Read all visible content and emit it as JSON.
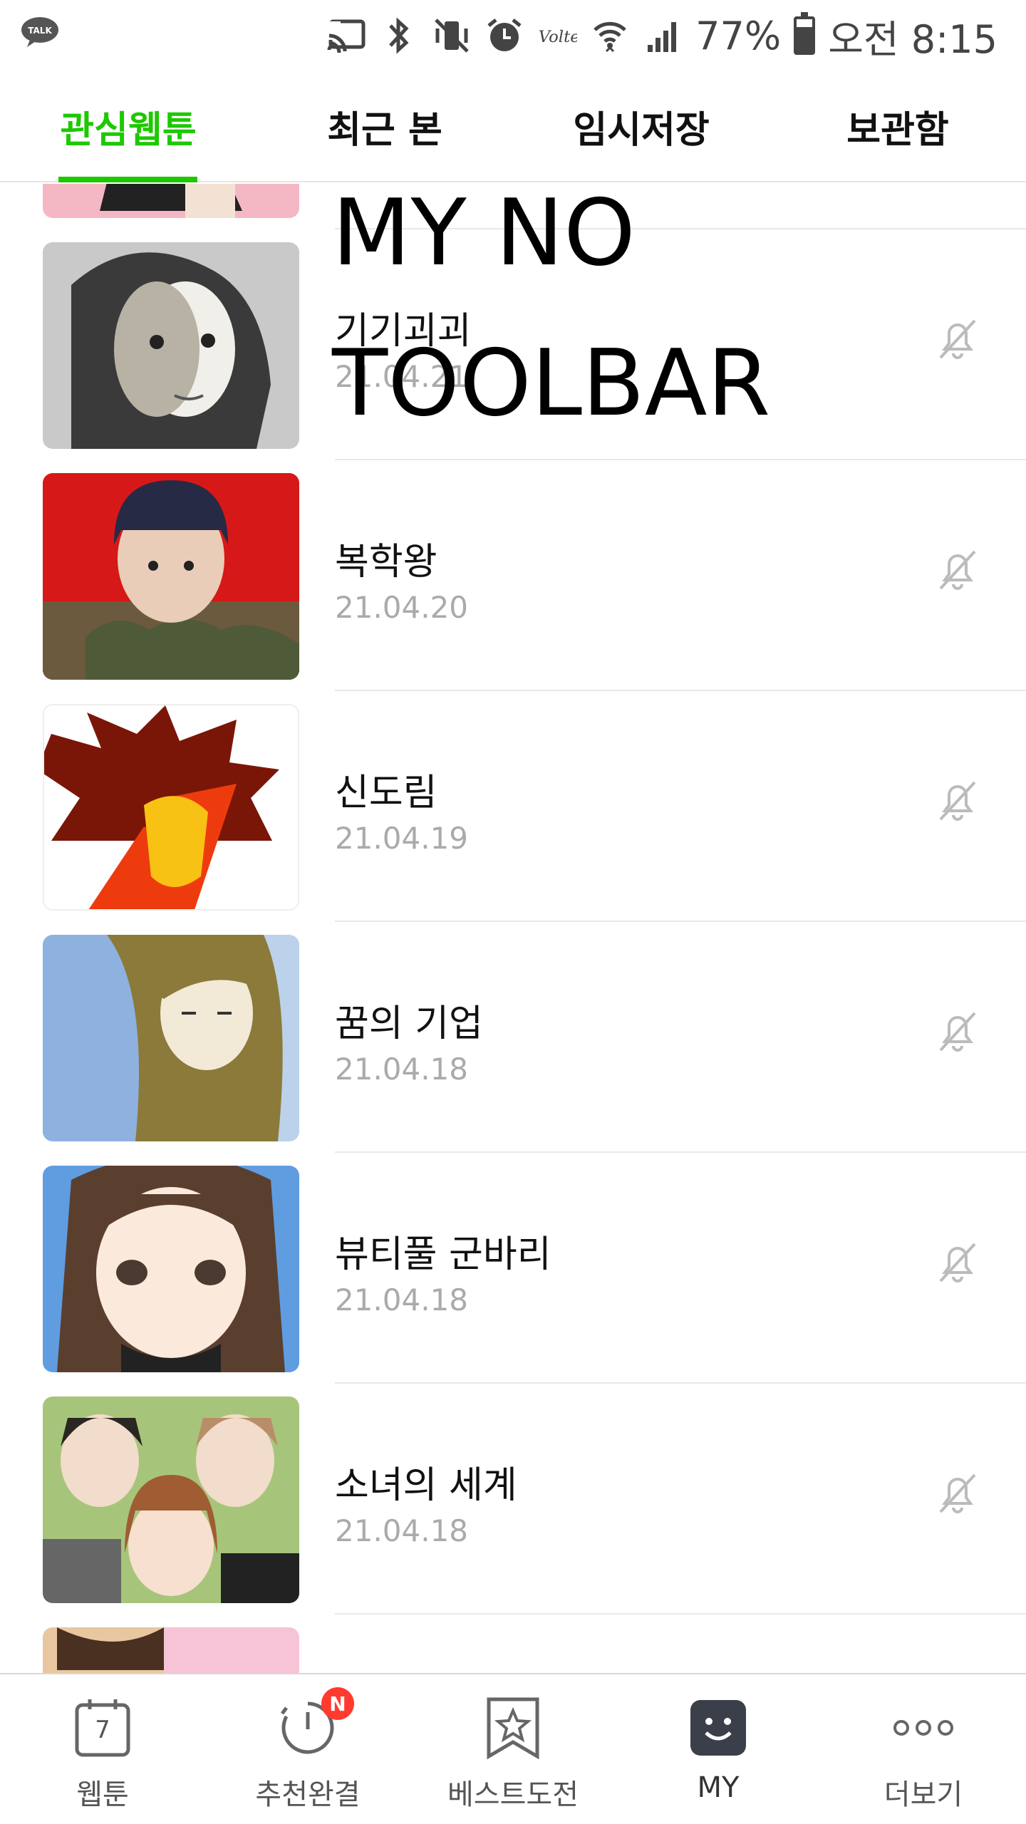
{
  "status_bar": {
    "talk_icon_label": "TALK",
    "battery_percent": "77%",
    "battery_level": 0.77,
    "time": "오전 8:15",
    "icons": [
      "cast-icon",
      "bluetooth-icon",
      "vibrate-mute-icon",
      "alarm-icon",
      "volte-icon",
      "wifi-icon",
      "signal-icon",
      "battery-icon"
    ]
  },
  "tabs": [
    {
      "label": "관심웹툰",
      "active": true
    },
    {
      "label": "최근 본",
      "active": false
    },
    {
      "label": "임시저장",
      "active": false
    },
    {
      "label": "보관함",
      "active": false
    }
  ],
  "overlay": {
    "line1": "MY NO",
    "line2": "TOOLBAR"
  },
  "list": {
    "items": [
      {
        "title": "기기괴괴",
        "date": "21.04.21"
      },
      {
        "title": "복학왕",
        "date": "21.04.20"
      },
      {
        "title": "신도림",
        "date": "21.04.19"
      },
      {
        "title": "꿈의 기업",
        "date": "21.04.18"
      },
      {
        "title": "뷰티풀 군바리",
        "date": "21.04.18"
      },
      {
        "title": "소녀의 세계",
        "date": "21.04.18"
      }
    ]
  },
  "bottom_nav": {
    "items": [
      {
        "label": "웹툰",
        "icon": "calendar-icon",
        "icon_text": "7"
      },
      {
        "label": "추천완결",
        "icon": "timer-icon",
        "badge": "N"
      },
      {
        "label": "베스트도전",
        "icon": "bookmark-star-icon"
      },
      {
        "label": "MY",
        "icon": "smile-icon",
        "active": true
      },
      {
        "label": "더보기",
        "icon": "more-icon"
      }
    ]
  },
  "colors": {
    "accent": "#1ec800",
    "badge": "#ff3b30",
    "date_text": "#aaaaaa"
  }
}
